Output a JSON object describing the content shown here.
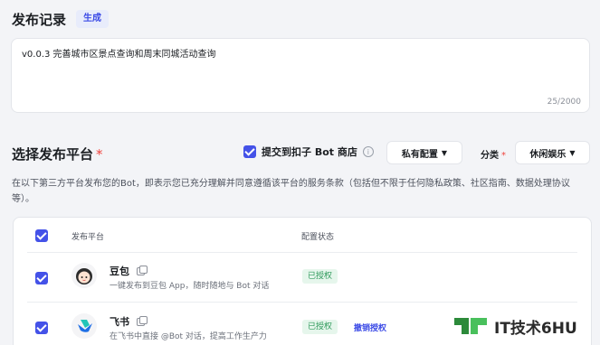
{
  "record": {
    "title": "发布记录",
    "generate_label": "生成",
    "content": "v0.0.3 完善城市区景点查询和周末同城活动查询",
    "counter": "25/2000"
  },
  "platform": {
    "title": "选择发布平台",
    "required_mark": "*",
    "submit_label": "提交到扣子 Bot 商店",
    "private_config_label": "私有配置",
    "category_label": "分类",
    "category_value": "休闲娱乐",
    "notice": "在以下第三方平台发布您的Bot，即表示您已充分理解并同意遵循该平台的服务条款（包括但不限于任何隐私政策、社区指南、数据处理协议等）。"
  },
  "table": {
    "col_platform": "发布平台",
    "col_status": "配置状态",
    "rows": [
      {
        "name": "豆包",
        "desc": "一键发布到豆包 App，随时随地与 Bot 对话",
        "status": "已授权",
        "action": ""
      },
      {
        "name": "飞书",
        "desc": "在飞书中直接 @Bot 对话，提高工作生产力",
        "status": "已授权",
        "action": "撤销授权"
      }
    ]
  },
  "watermark": {
    "text": "IT技术6HU"
  },
  "colors": {
    "accent": "#4452e8",
    "success": "#2f9a5b",
    "danger": "#f0443e"
  }
}
